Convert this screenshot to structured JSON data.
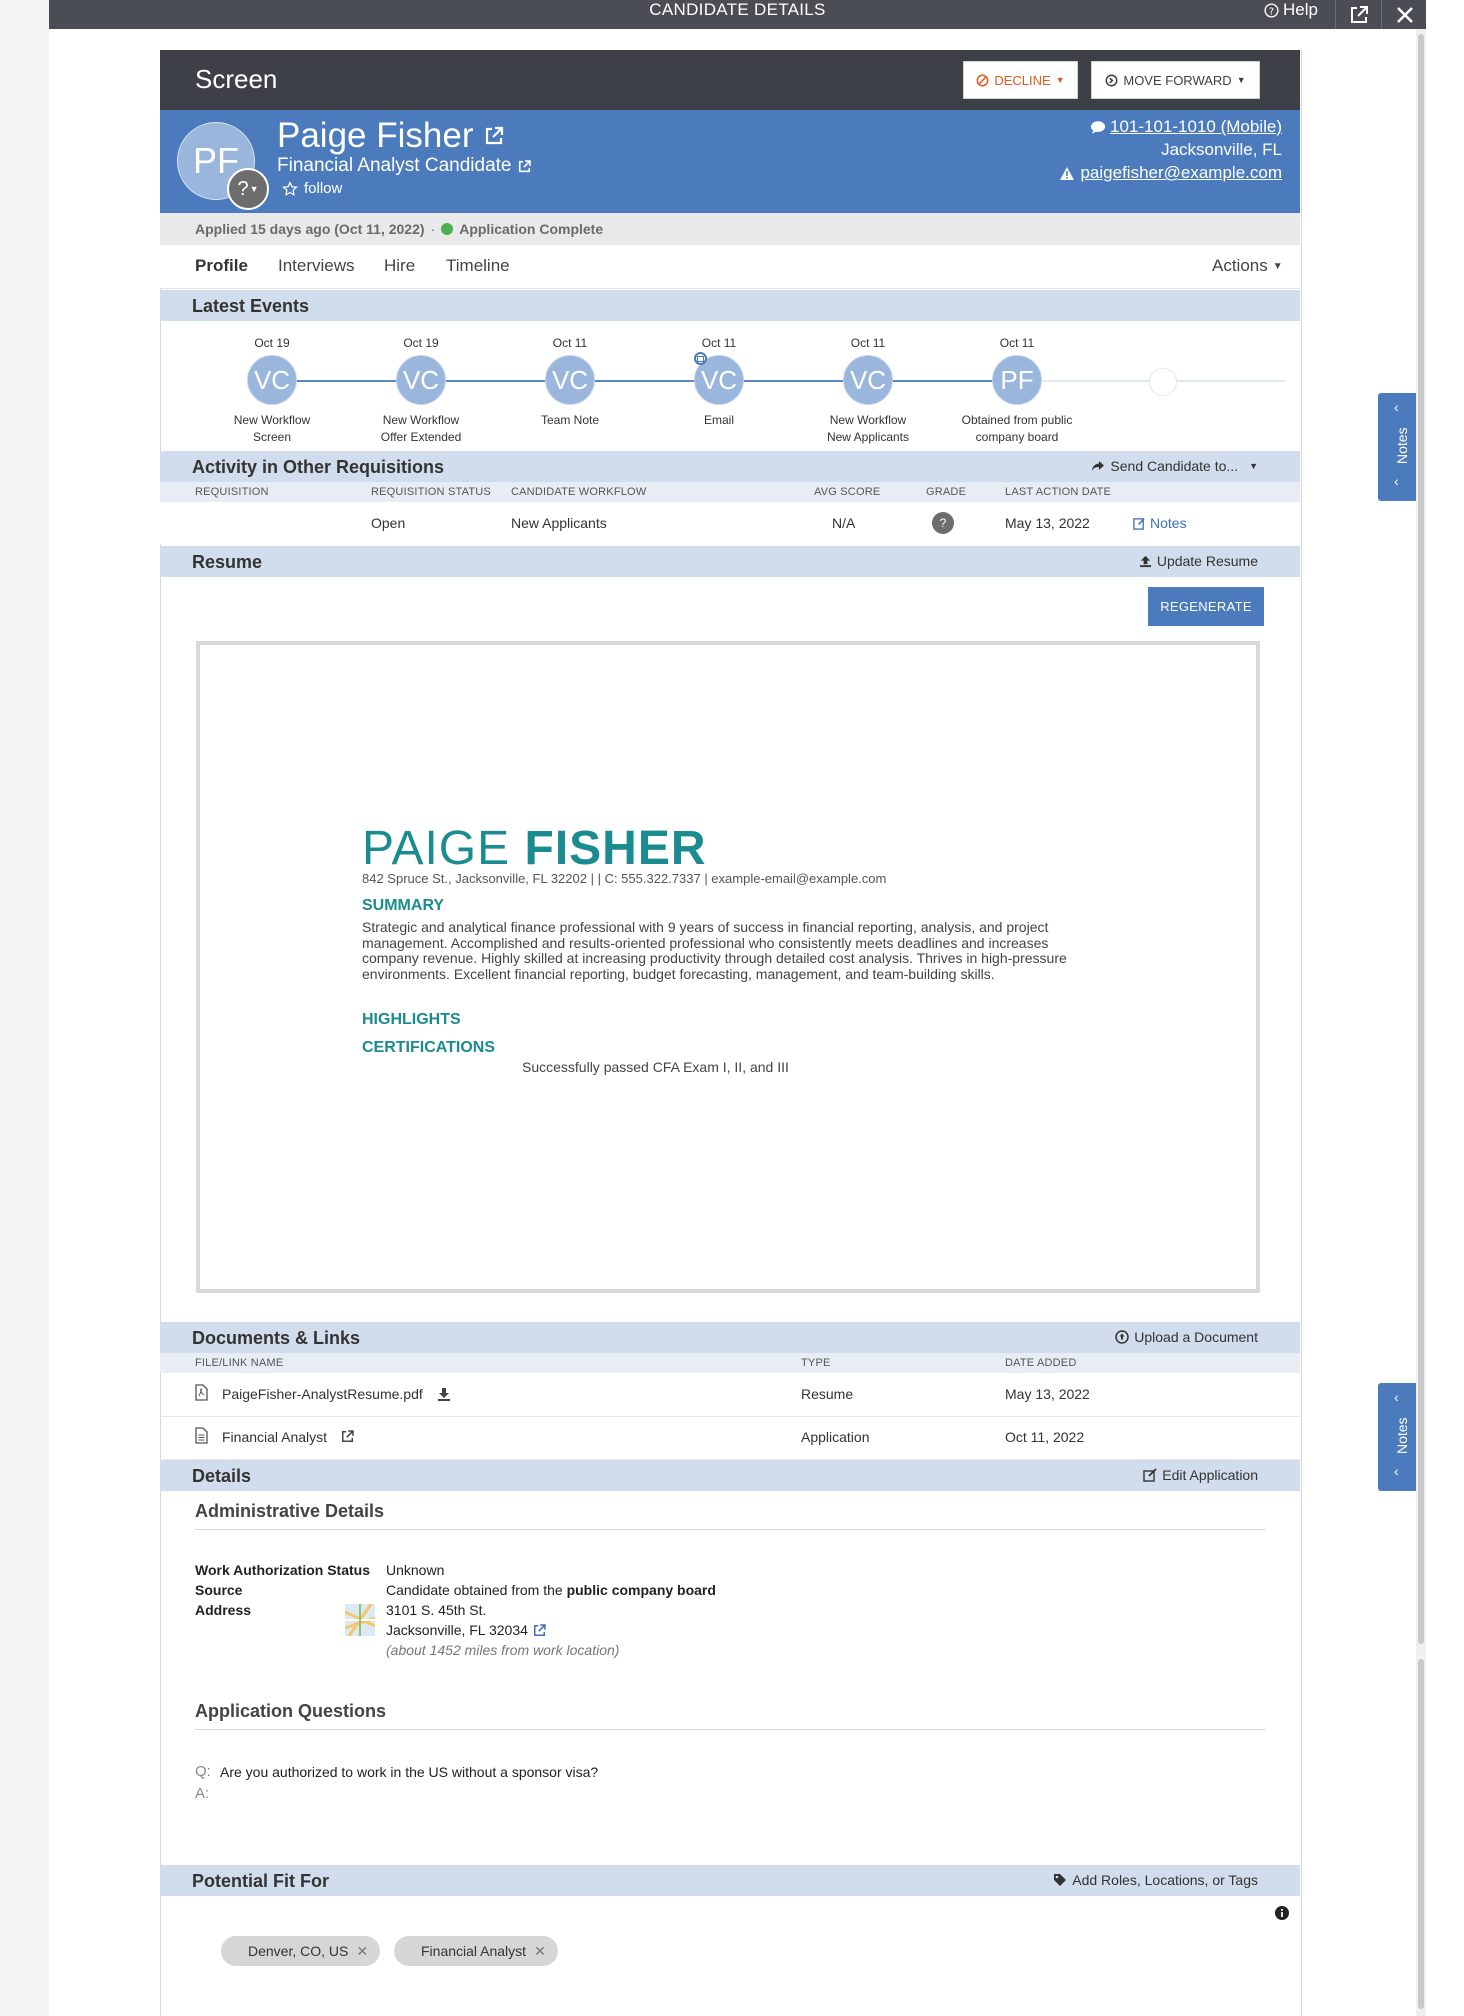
{
  "window": {
    "title": "CANDIDATE DETAILS",
    "help_label": "Help"
  },
  "screen": {
    "title": "Screen",
    "decline_label": "DECLINE",
    "move_forward_label": "MOVE FORWARD"
  },
  "candidate": {
    "initials": "PF",
    "avatar_badge": "?",
    "name": "Paige Fisher",
    "job": "Financial Analyst Candidate",
    "follow_label": "follow",
    "phone": "101-101-1010 (Mobile)",
    "location": "Jacksonville, FL",
    "email": "paigefisher@example.com"
  },
  "status": {
    "applied": "Applied 15 days ago (Oct 11, 2022)",
    "separator": "·",
    "application": "Application Complete",
    "dot_color": "#4caf50"
  },
  "tabs": [
    "Profile",
    "Interviews",
    "Hire",
    "Timeline"
  ],
  "actions_label": "Actions",
  "latest_events": {
    "title": "Latest Events",
    "events": [
      {
        "date": "Oct 19",
        "initials": "VC",
        "line1": "New Workflow",
        "line2": "Screen"
      },
      {
        "date": "Oct 19",
        "initials": "VC",
        "line1": "New Workflow",
        "line2": "Offer Extended"
      },
      {
        "date": "Oct 11",
        "initials": "VC",
        "line1": "Team Note",
        "line2": ""
      },
      {
        "date": "Oct 11",
        "initials": "VC",
        "line1": "Email",
        "line2": ""
      },
      {
        "date": "Oct 11",
        "initials": "VC",
        "line1": "New Workflow",
        "line2": "New Applicants"
      },
      {
        "date": "Oct 11",
        "initials": "PF",
        "line1": "Obtained from public",
        "line2": "company board"
      }
    ]
  },
  "other_requisitions": {
    "title": "Activity in Other Requisitions",
    "send_label": "Send Candidate to...",
    "columns": [
      "REQUISITION",
      "REQUISITION STATUS",
      "CANDIDATE WORKFLOW",
      "AVG SCORE",
      "GRADE",
      "LAST ACTION DATE"
    ],
    "row": {
      "requisition": "",
      "status": "Open",
      "workflow": "New Applicants",
      "avg_score": "N/A",
      "grade": "?",
      "last_action": "May 13, 2022",
      "notes_label": "Notes"
    }
  },
  "resume": {
    "title": "Resume",
    "update_label": "Update Resume",
    "regenerate_label": "REGENERATE",
    "doc": {
      "first_name": "PAIGE",
      "last_name": "FISHER",
      "contact": "842 Spruce St., Jacksonville, FL 32202 |  | C: 555.322.7337 | example-email@example.com",
      "summary_heading": "SUMMARY",
      "summary": "Strategic and analytical finance professional with 9 years of success in financial reporting, analysis, and project management. Accomplished and results-oriented professional who consistently meets deadlines and increases company revenue. Highly skilled at increasing productivity through detailed cost analysis. Thrives in high-pressure environments. Excellent financial reporting, budget forecasting, management, and team-building skills.",
      "highlights_heading": "HIGHLIGHTS",
      "certifications_heading": "CERTIFICATIONS",
      "certification": "Successfully passed CFA Exam I, II, and III"
    }
  },
  "documents": {
    "title": "Documents & Links",
    "upload_label": "Upload a Document",
    "columns": [
      "FILE/LINK NAME",
      "TYPE",
      "DATE ADDED"
    ],
    "rows": [
      {
        "name": "PaigeFisher-AnalystResume.pdf",
        "type": "Resume",
        "date": "May 13, 2022"
      },
      {
        "name": "Financial Analyst",
        "type": "Application",
        "date": "Oct 11, 2022"
      }
    ]
  },
  "details": {
    "title": "Details",
    "edit_label": "Edit Application",
    "admin_heading": "Administrative Details",
    "work_auth_key": "Work Authorization Status",
    "work_auth_value": "Unknown",
    "source_key": "Source",
    "source_prefix": "Candidate obtained from the",
    "source_bold": "public company board",
    "address_key": "Address",
    "address_line1": "3101 S. 45th St.",
    "address_line2": "Jacksonville, FL 32034",
    "address_distance": "(about 1452 miles from work location)",
    "questions_heading": "Application Questions",
    "q_label": "Q:",
    "question": "Are you authorized to work in the US without a sponsor visa?",
    "a_label": "A:"
  },
  "potential_fit": {
    "title": "Potential Fit For",
    "add_label": "Add Roles, Locations, or Tags",
    "tags": [
      "Denver, CO, US",
      "Financial Analyst"
    ]
  },
  "notes_tab_label": "Notes",
  "colors": {
    "primary": "#4b7bbd",
    "section": "#d1dcec",
    "decline": "#e05a1c",
    "teal": "#1a8b8e"
  }
}
